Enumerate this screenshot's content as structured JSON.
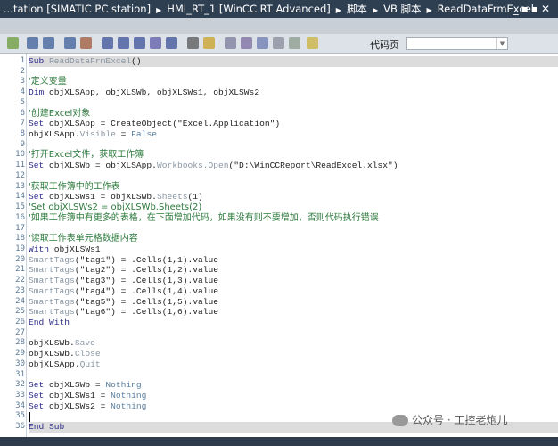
{
  "titlebar": {
    "crumbs": [
      "...tation [SIMATIC PC station]",
      "HMI_RT_1 [WinCC RT Advanced]",
      "脚本",
      "VB 脚本",
      "ReadDataFrmExcel"
    ],
    "window_controls": "_▪▪✕"
  },
  "toolbar": {
    "code_page_label": "代码页",
    "code_page_value": "",
    "dropdown_icon": "▼"
  },
  "watermark": "公众号 · 工控老炮儿",
  "code": [
    [
      [
        "kw",
        "Sub "
      ],
      [
        "md",
        "ReadDataFrmExcel"
      ],
      [
        "tx",
        "()"
      ]
    ],
    [],
    [
      [
        "cm",
        "'定义变量"
      ]
    ],
    [
      [
        "kw",
        "Dim "
      ],
      [
        "tx",
        "objXLSApp, objXLSWb, objXLSWs1, objXLSWs2"
      ]
    ],
    [],
    [
      [
        "cm",
        "'创建Excel对象"
      ]
    ],
    [
      [
        "kw",
        "Set "
      ],
      [
        "tx",
        "objXLSApp = CreateObject(\"Excel.Application\")"
      ]
    ],
    [
      [
        "tx",
        "objXLSApp."
      ],
      [
        "md",
        "Visible"
      ],
      [
        "tx",
        " = "
      ],
      [
        "cc",
        "False"
      ]
    ],
    [],
    [
      [
        "cm",
        "'打开Excel文件，获取工作簿"
      ]
    ],
    [
      [
        "kw",
        "Set "
      ],
      [
        "tx",
        "objXLSWb = objXLSApp."
      ],
      [
        "md",
        "Workbooks.Open"
      ],
      [
        "tx",
        "(\"D:\\WinCCReport\\ReadExcel.xlsx\")"
      ]
    ],
    [],
    [
      [
        "cm",
        "'获取工作簿中的工作表"
      ]
    ],
    [
      [
        "kw",
        "Set "
      ],
      [
        "tx",
        "objXLSWs1 = objXLSWb."
      ],
      [
        "md",
        "Sheets"
      ],
      [
        "tx",
        "(1)"
      ]
    ],
    [
      [
        "cm",
        "'Set objXLSWs2 = objXLSWb.Sheets(2)"
      ]
    ],
    [
      [
        "cm",
        "'如果工作簿中有更多的表格，在下面增加代码，如果没有则不要增加，否则代码执行错误"
      ]
    ],
    [],
    [
      [
        "cm",
        "'读取工作表单元格数据内容"
      ]
    ],
    [
      [
        "kw",
        "With "
      ],
      [
        "tx",
        "objXLSWs1"
      ]
    ],
    [
      [
        "md",
        "SmartTags"
      ],
      [
        "tx",
        "(\"tag1\") = .Cells(1,1).value"
      ]
    ],
    [
      [
        "md",
        "SmartTags"
      ],
      [
        "tx",
        "(\"tag2\") = .Cells(1,2).value"
      ]
    ],
    [
      [
        "md",
        "SmartTags"
      ],
      [
        "tx",
        "(\"tag3\") = .Cells(1,3).value"
      ]
    ],
    [
      [
        "md",
        "SmartTags"
      ],
      [
        "tx",
        "(\"tag4\") = .Cells(1,4).value"
      ]
    ],
    [
      [
        "md",
        "SmartTags"
      ],
      [
        "tx",
        "(\"tag5\") = .Cells(1,5).value"
      ]
    ],
    [
      [
        "md",
        "SmartTags"
      ],
      [
        "tx",
        "(\"tag6\") = .Cells(1,6).value"
      ]
    ],
    [
      [
        "kw",
        "End With"
      ]
    ],
    [],
    [
      [
        "tx",
        "objXLSWb."
      ],
      [
        "md",
        "Save"
      ]
    ],
    [
      [
        "tx",
        "objXLSWb."
      ],
      [
        "md",
        "Close"
      ]
    ],
    [
      [
        "tx",
        "objXLSApp."
      ],
      [
        "md",
        "Quit"
      ]
    ],
    [],
    [
      [
        "kw",
        "Set "
      ],
      [
        "tx",
        "objXLSWb = "
      ],
      [
        "cc",
        "Nothing"
      ]
    ],
    [
      [
        "kw",
        "Set "
      ],
      [
        "tx",
        "objXLSWs1 = "
      ],
      [
        "cc",
        "Nothing"
      ]
    ],
    [
      [
        "kw",
        "Set "
      ],
      [
        "tx",
        "objXLSWs2 = "
      ],
      [
        "cc",
        "Nothing"
      ]
    ],
    [],
    [
      [
        "kw",
        "End Sub"
      ]
    ]
  ]
}
